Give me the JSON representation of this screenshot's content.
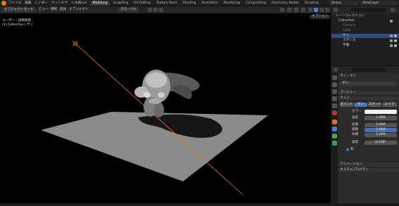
{
  "topbar": {
    "menus": [
      "ファイル",
      "編集",
      "レンダー",
      "ウィンドウ",
      "ヘルプ"
    ],
    "tabs": [
      "Layout",
      "Modeling",
      "Sculpting",
      "UV Editing",
      "Texture Paint",
      "Shading",
      "Animation",
      "Rendering",
      "Compositing",
      "Geometry Nodes",
      "Scripting"
    ],
    "active_tab": "Modeling",
    "scene": "Scene",
    "view_layer": "ViewLayer"
  },
  "viewport_header": {
    "mode": "オブジェクトモード",
    "menus": [
      "ビュー",
      "選択",
      "追加",
      "オブジェクト"
    ],
    "transform": "グローバル",
    "options": "オプション"
  },
  "viewport_info": {
    "line1": "ユーザー・透視投影",
    "line2": "(1) Collection | サン"
  },
  "outliner": {
    "title": "シーンコレクション",
    "rows": [
      {
        "label": "Collection",
        "selected": false
      },
      {
        "label": "Camera",
        "selected": false
      },
      {
        "label": "Light",
        "selected": false
      },
      {
        "label": "サン",
        "selected": true
      },
      {
        "label": "スザンヌ",
        "selected": false
      },
      {
        "label": "平面",
        "selected": false
      }
    ]
  },
  "properties": {
    "search_placeholder": "",
    "breadcrumb_1": "サン",
    "breadcrumb_2": "サン",
    "object_name": "サン",
    "sections": {
      "preview": "プレビュー",
      "light": "ライト",
      "animation": "アニメーション",
      "custom_props": "カスタムプロパティ"
    },
    "light_types": [
      "ポイント",
      "サン",
      "スポット",
      "エリア"
    ],
    "active_light_type": "サン",
    "color_label": "カラー",
    "strength_label": "強度",
    "strength_value": "1.000",
    "angle_label": "角度",
    "angle_value": "0.526°",
    "shadow_label": "影",
    "specular_label": "鏡面",
    "diffuse_label": "拡散",
    "diffuse_value": "1.000",
    "specular_value": "1.000",
    "volume_label": "体積",
    "volume_value": "1.000"
  },
  "colors": {
    "accent": "#4772b3",
    "brand": "#e87d0d",
    "light_line": "#e07a10",
    "plane": "#8a8a8a"
  }
}
